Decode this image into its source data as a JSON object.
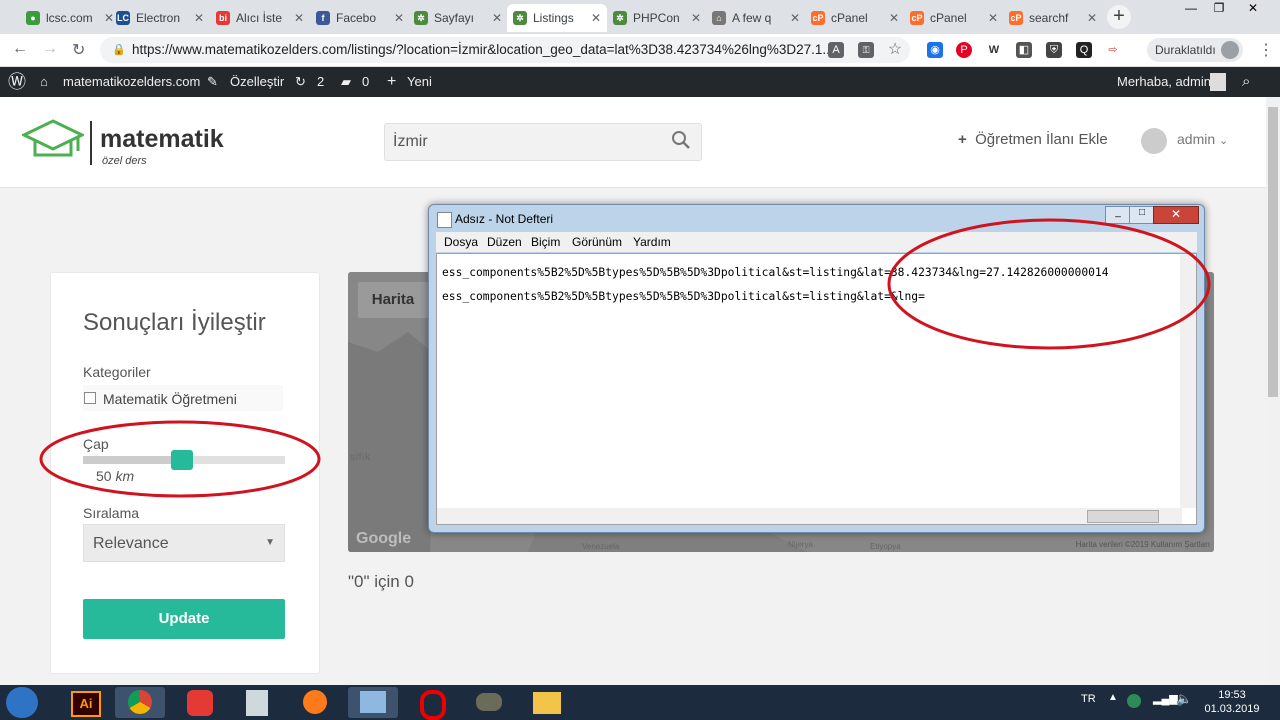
{
  "browser": {
    "tabs": [
      {
        "label": "lcsc.com",
        "color": "#3a9c3a",
        "glyph": "●"
      },
      {
        "label": "Electron",
        "color": "#1d4f91",
        "glyph": "LC"
      },
      {
        "label": "Alıcı İste",
        "color": "#e53935",
        "glyph": "bi"
      },
      {
        "label": "Facebo",
        "color": "#3b5998",
        "glyph": "f"
      },
      {
        "label": "Sayfayı",
        "color": "#4e8a3d",
        "glyph": "✲"
      },
      {
        "label": "Listings",
        "color": "#4e8a3d",
        "glyph": "✲"
      },
      {
        "label": "PHPCon",
        "color": "#4e8a3d",
        "glyph": "✲"
      },
      {
        "label": "A few q",
        "color": "#777777",
        "glyph": "⌂"
      },
      {
        "label": "cPanel",
        "color": "#ff6c2c",
        "glyph": "cP"
      },
      {
        "label": "cPanel",
        "color": "#ff6c2c",
        "glyph": "cP"
      },
      {
        "label": "searchf",
        "color": "#ff6c2c",
        "glyph": "cP"
      }
    ],
    "url": "https://www.matematikozelders.com/listings/?location=İzmir&location_geo_data=lat%3D38.423734%26lng%3D27.1...",
    "paused_label": "Duraklatıldı"
  },
  "wpbar": {
    "site": "matematikozelders.com",
    "customize": "Özelleştir",
    "updates": "2",
    "comments": "0",
    "new": "Yeni",
    "greeting": "Merhaba, admin"
  },
  "site": {
    "logo_title": "matematik",
    "logo_sub": "özel ders",
    "search_value": "İzmir",
    "add_listing": "Öğretmen İlanı Ekle",
    "user": "admin"
  },
  "filters": {
    "title": "Sonuçları İyileştir",
    "categories_label": "Kategoriler",
    "category_option": "Matematik Öğretmeni",
    "radius_label": "Çap",
    "radius_value": "50",
    "radius_unit": "km",
    "radius_fraction": 0.49,
    "sort_label": "Sıralama",
    "sort_value": "Relevance",
    "update_button": "Update"
  },
  "map": {
    "tab": "Harita",
    "google": "Google",
    "footer": "Harita verileri ©2019  Kullanım Şartları",
    "place1": "Venezuela",
    "place2": "Nijerya",
    "place3": "Etiyopya",
    "ocean": "sifik"
  },
  "results_text": "\"0\" için 0",
  "notepad": {
    "title": "Adsız - Not Defteri",
    "menu": [
      "Dosya",
      "Düzen",
      "Biçim",
      "Görünüm",
      "Yardım"
    ],
    "line1": "ess_components%5B2%5D%5Btypes%5D%5B%5D%3Dpolitical&st=listing&lat=38.423734&lng=27.142826000000014",
    "line2": "ess_components%5B2%5D%5Btypes%5D%5B%5D%3Dpolitical&st=listing&lat=&lng="
  },
  "taskbar": {
    "lang": "TR",
    "time": "19:53",
    "date": "01.03.2019"
  },
  "colors": {
    "accent": "#26b99a",
    "annotation": "#d0131f"
  }
}
